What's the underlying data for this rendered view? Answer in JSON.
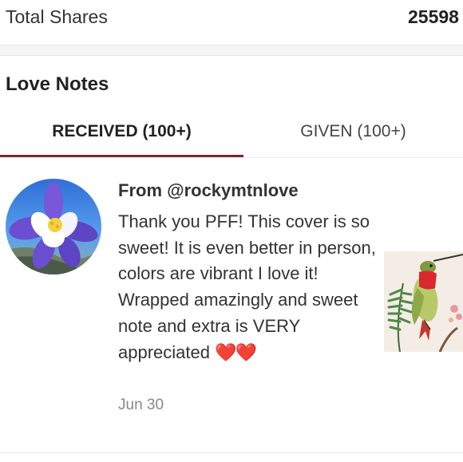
{
  "stats": {
    "label": "Total Shares",
    "value": "25598"
  },
  "love_notes": {
    "title": "Love Notes",
    "tabs": [
      {
        "label": "RECEIVED (100+)",
        "active": true
      },
      {
        "label": "GIVEN (100+)",
        "active": false
      }
    ],
    "note": {
      "avatar_icon": "columbine-flower-avatar",
      "from": "From @rockymtnlove",
      "message": "Thank you PFF! This cover is so sweet! It is even better in person, colors are vibrant I love it! Wrapped amazingly and sweet note and extra is VERY appreciated",
      "emoji": "❤️❤️",
      "date": "Jun 30",
      "listing_thumbnail_icon": "hummingbird-illustration-thumbnail"
    }
  },
  "colors": {
    "accent": "#7a2530",
    "heart": "#d21e2b",
    "muted_text": "#888888"
  }
}
